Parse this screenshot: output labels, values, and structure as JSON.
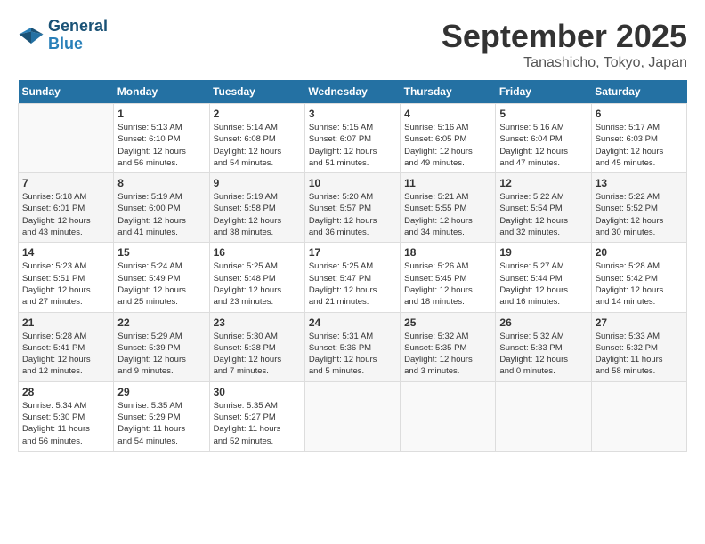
{
  "logo": {
    "line1": "General",
    "line2": "Blue"
  },
  "title": "September 2025",
  "location": "Tanashicho, Tokyo, Japan",
  "weekdays": [
    "Sunday",
    "Monday",
    "Tuesday",
    "Wednesday",
    "Thursday",
    "Friday",
    "Saturday"
  ],
  "weeks": [
    [
      {
        "day": "",
        "info": ""
      },
      {
        "day": "1",
        "info": "Sunrise: 5:13 AM\nSunset: 6:10 PM\nDaylight: 12 hours\nand 56 minutes."
      },
      {
        "day": "2",
        "info": "Sunrise: 5:14 AM\nSunset: 6:08 PM\nDaylight: 12 hours\nand 54 minutes."
      },
      {
        "day": "3",
        "info": "Sunrise: 5:15 AM\nSunset: 6:07 PM\nDaylight: 12 hours\nand 51 minutes."
      },
      {
        "day": "4",
        "info": "Sunrise: 5:16 AM\nSunset: 6:05 PM\nDaylight: 12 hours\nand 49 minutes."
      },
      {
        "day": "5",
        "info": "Sunrise: 5:16 AM\nSunset: 6:04 PM\nDaylight: 12 hours\nand 47 minutes."
      },
      {
        "day": "6",
        "info": "Sunrise: 5:17 AM\nSunset: 6:03 PM\nDaylight: 12 hours\nand 45 minutes."
      }
    ],
    [
      {
        "day": "7",
        "info": "Sunrise: 5:18 AM\nSunset: 6:01 PM\nDaylight: 12 hours\nand 43 minutes."
      },
      {
        "day": "8",
        "info": "Sunrise: 5:19 AM\nSunset: 6:00 PM\nDaylight: 12 hours\nand 41 minutes."
      },
      {
        "day": "9",
        "info": "Sunrise: 5:19 AM\nSunset: 5:58 PM\nDaylight: 12 hours\nand 38 minutes."
      },
      {
        "day": "10",
        "info": "Sunrise: 5:20 AM\nSunset: 5:57 PM\nDaylight: 12 hours\nand 36 minutes."
      },
      {
        "day": "11",
        "info": "Sunrise: 5:21 AM\nSunset: 5:55 PM\nDaylight: 12 hours\nand 34 minutes."
      },
      {
        "day": "12",
        "info": "Sunrise: 5:22 AM\nSunset: 5:54 PM\nDaylight: 12 hours\nand 32 minutes."
      },
      {
        "day": "13",
        "info": "Sunrise: 5:22 AM\nSunset: 5:52 PM\nDaylight: 12 hours\nand 30 minutes."
      }
    ],
    [
      {
        "day": "14",
        "info": "Sunrise: 5:23 AM\nSunset: 5:51 PM\nDaylight: 12 hours\nand 27 minutes."
      },
      {
        "day": "15",
        "info": "Sunrise: 5:24 AM\nSunset: 5:49 PM\nDaylight: 12 hours\nand 25 minutes."
      },
      {
        "day": "16",
        "info": "Sunrise: 5:25 AM\nSunset: 5:48 PM\nDaylight: 12 hours\nand 23 minutes."
      },
      {
        "day": "17",
        "info": "Sunrise: 5:25 AM\nSunset: 5:47 PM\nDaylight: 12 hours\nand 21 minutes."
      },
      {
        "day": "18",
        "info": "Sunrise: 5:26 AM\nSunset: 5:45 PM\nDaylight: 12 hours\nand 18 minutes."
      },
      {
        "day": "19",
        "info": "Sunrise: 5:27 AM\nSunset: 5:44 PM\nDaylight: 12 hours\nand 16 minutes."
      },
      {
        "day": "20",
        "info": "Sunrise: 5:28 AM\nSunset: 5:42 PM\nDaylight: 12 hours\nand 14 minutes."
      }
    ],
    [
      {
        "day": "21",
        "info": "Sunrise: 5:28 AM\nSunset: 5:41 PM\nDaylight: 12 hours\nand 12 minutes."
      },
      {
        "day": "22",
        "info": "Sunrise: 5:29 AM\nSunset: 5:39 PM\nDaylight: 12 hours\nand 9 minutes."
      },
      {
        "day": "23",
        "info": "Sunrise: 5:30 AM\nSunset: 5:38 PM\nDaylight: 12 hours\nand 7 minutes."
      },
      {
        "day": "24",
        "info": "Sunrise: 5:31 AM\nSunset: 5:36 PM\nDaylight: 12 hours\nand 5 minutes."
      },
      {
        "day": "25",
        "info": "Sunrise: 5:32 AM\nSunset: 5:35 PM\nDaylight: 12 hours\nand 3 minutes."
      },
      {
        "day": "26",
        "info": "Sunrise: 5:32 AM\nSunset: 5:33 PM\nDaylight: 12 hours\nand 0 minutes."
      },
      {
        "day": "27",
        "info": "Sunrise: 5:33 AM\nSunset: 5:32 PM\nDaylight: 11 hours\nand 58 minutes."
      }
    ],
    [
      {
        "day": "28",
        "info": "Sunrise: 5:34 AM\nSunset: 5:30 PM\nDaylight: 11 hours\nand 56 minutes."
      },
      {
        "day": "29",
        "info": "Sunrise: 5:35 AM\nSunset: 5:29 PM\nDaylight: 11 hours\nand 54 minutes."
      },
      {
        "day": "30",
        "info": "Sunrise: 5:35 AM\nSunset: 5:27 PM\nDaylight: 11 hours\nand 52 minutes."
      },
      {
        "day": "",
        "info": ""
      },
      {
        "day": "",
        "info": ""
      },
      {
        "day": "",
        "info": ""
      },
      {
        "day": "",
        "info": ""
      }
    ]
  ]
}
